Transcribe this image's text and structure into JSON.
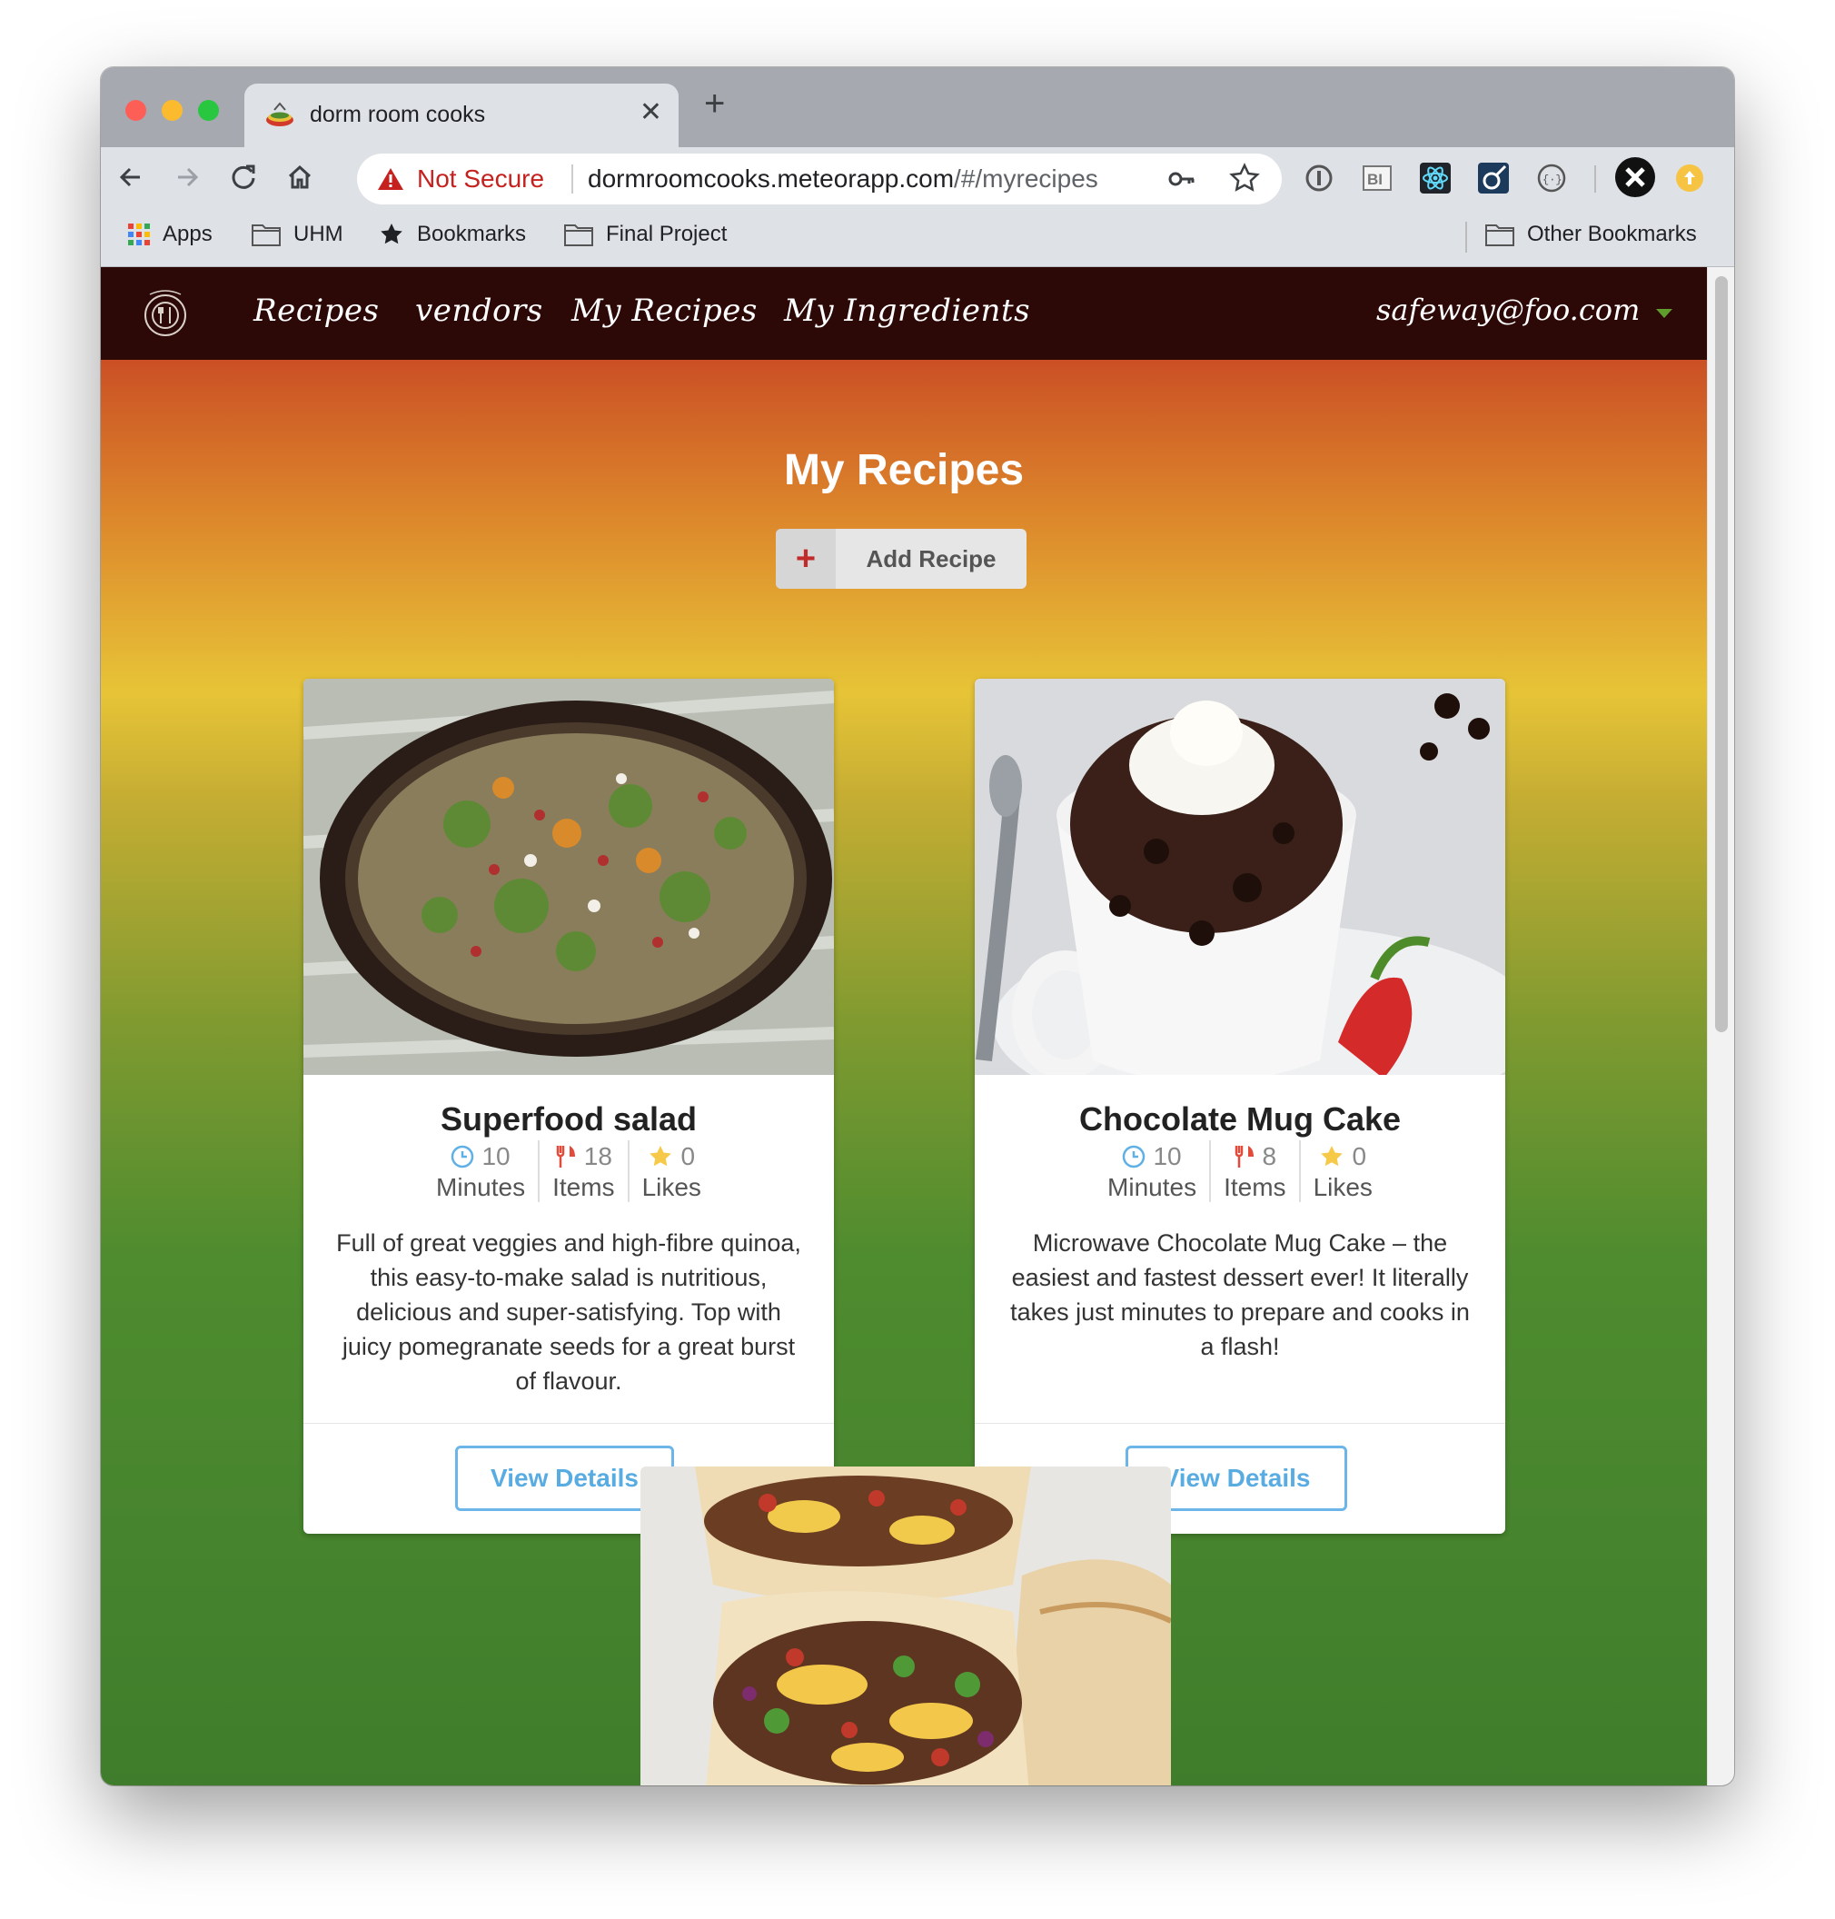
{
  "browser": {
    "tab_title": "dorm room cooks",
    "security_label": "Not Secure",
    "url_host": "dormroomcooks.meteorapp.com",
    "url_path": "/#/myrecipes",
    "bookmarks": [
      "Apps",
      "UHM",
      "Bookmarks",
      "Final Project"
    ],
    "other_bookmarks": "Other Bookmarks"
  },
  "app_nav": {
    "links": [
      "Recipes",
      "vendors",
      "My Recipes",
      "My Ingredients"
    ],
    "user": "safeway@foo.com"
  },
  "page": {
    "title": "My Recipes",
    "add_button": "Add Recipe"
  },
  "recipes": [
    {
      "title": "Superfood salad",
      "time": "10",
      "time_label": "Minutes",
      "items": "18",
      "items_label": "Items",
      "likes": "0",
      "likes_label": "Likes",
      "description": "Full of great veggies and high-fibre quinoa, this easy-to-make salad is nutritious, delicious and super-satisfying. Top with juicy pomegranate seeds for a great burst of flavour.",
      "button": "View Details"
    },
    {
      "title": "Chocolate Mug Cake",
      "time": "10",
      "time_label": "Minutes",
      "items": "8",
      "items_label": "Items",
      "likes": "0",
      "likes_label": "Likes",
      "description": "Microwave Chocolate Mug Cake – the easiest and fastest dessert ever! It literally takes just minutes to prepare and cooks in a flash!",
      "button": "View Details"
    }
  ],
  "colors": {
    "nav_bg": "#2c0807",
    "accent_blue": "#59ace2",
    "gradient_top": "#b83221",
    "gradient_mid": "#e7c437",
    "gradient_bottom": "#3f7d2c"
  }
}
